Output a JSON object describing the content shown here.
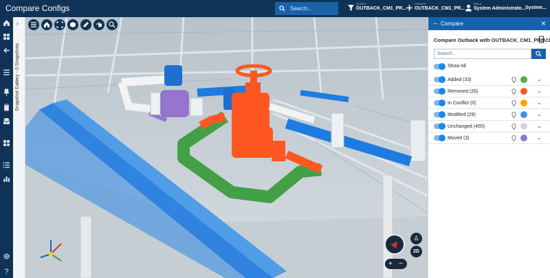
{
  "app": {
    "title": "Compare Configs"
  },
  "topbar": {
    "search_placeholder": "Search...",
    "query_key": "QUERY",
    "query_value": "OUTBACK_CM1_PR...",
    "create_key": "CREATE",
    "create_value": "OUTBACK_CM1_PR...",
    "role_key": "ROLE",
    "role_value": "System Administrato...",
    "system_label": "System..."
  },
  "left_rail": {
    "icons": [
      "home-icon",
      "dashboard-icon",
      "arrow-left-icon",
      "list-icon",
      "pin-icon",
      "clipboard-icon",
      "inbox-icon",
      "grid-icon",
      "list-alt-icon",
      "chart-icon",
      "settings-icon",
      "help-icon"
    ]
  },
  "gallery": {
    "label": "Snapshot Gallery - 0 Snapshots"
  },
  "viewer_toolbar": {
    "icons": [
      "menu-icon",
      "home-icon",
      "fit-view-icon",
      "cube-icon",
      "measure-icon",
      "section-icon",
      "zoom-region-icon"
    ]
  },
  "panel": {
    "header": "Compare",
    "compare_title": "Compare Outback with OUTBACK_CM1_PROJ1",
    "search_placeholder": "Search...",
    "show_all": "Show All",
    "rows": [
      {
        "label": "Added (33)",
        "color": "#4caf50"
      },
      {
        "label": "Removed (26)",
        "color": "#ff5722"
      },
      {
        "label": "In Conflict (0)",
        "color": "#ffa000"
      },
      {
        "label": "Modified (29)",
        "color": "#3f8fe0"
      },
      {
        "label": "Unchanged (455)",
        "color": "#d4d4d4"
      },
      {
        "label": "Moved (3)",
        "color": "#9575cd"
      }
    ]
  },
  "nav": {
    "btn_2d": "2D",
    "zoom_in": "+",
    "zoom_out": "−"
  },
  "colors": {
    "brand": "#0f3356",
    "accent": "#1862a8"
  }
}
